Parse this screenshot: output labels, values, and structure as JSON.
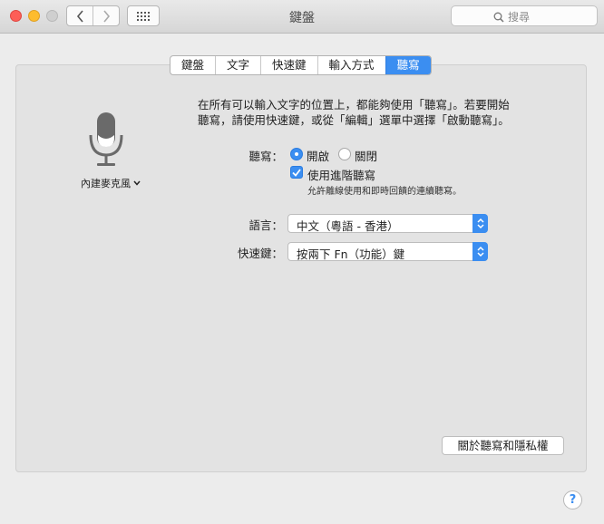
{
  "window": {
    "title": "鍵盤"
  },
  "toolbar": {
    "back_icon": "chevron-left-icon",
    "forward_icon": "chevron-right-icon",
    "show_all_icon": "grid-icon",
    "search_icon": "magnifier-icon",
    "search_placeholder": "搜尋"
  },
  "tabs": [
    {
      "label": "鍵盤",
      "active": false
    },
    {
      "label": "文字",
      "active": false
    },
    {
      "label": "快速鍵",
      "active": false
    },
    {
      "label": "輸入方式",
      "active": false
    },
    {
      "label": "聽寫",
      "active": true
    }
  ],
  "mic": {
    "icon": "microphone-icon",
    "source_label": "內建麥克風"
  },
  "description": {
    "line1": "在所有可以輸入文字的位置上，都能夠使用「聽寫」。若要開始",
    "line2": "聽寫，請使用快速鍵，或從「編輯」選單中選擇「啟動聽寫」。"
  },
  "dictation": {
    "label": "聽寫：",
    "on_label": "開啟",
    "off_label": "關閉",
    "selected": "on",
    "enhanced_label": "使用進階聽寫",
    "enhanced_checked": true,
    "enhanced_hint": "允許離線使用和即時回饋的連續聽寫。"
  },
  "language": {
    "label": "語言：",
    "value": "中文（粵語 - 香港）"
  },
  "shortcut": {
    "label": "快速鍵：",
    "value": "按兩下 Fn（功能）鍵"
  },
  "about_button": "關於聽寫和隱私權",
  "help_button": "?",
  "colors": {
    "accent": "#3b8ef1",
    "panel": "#e3e3e3",
    "window": "#ececec"
  }
}
